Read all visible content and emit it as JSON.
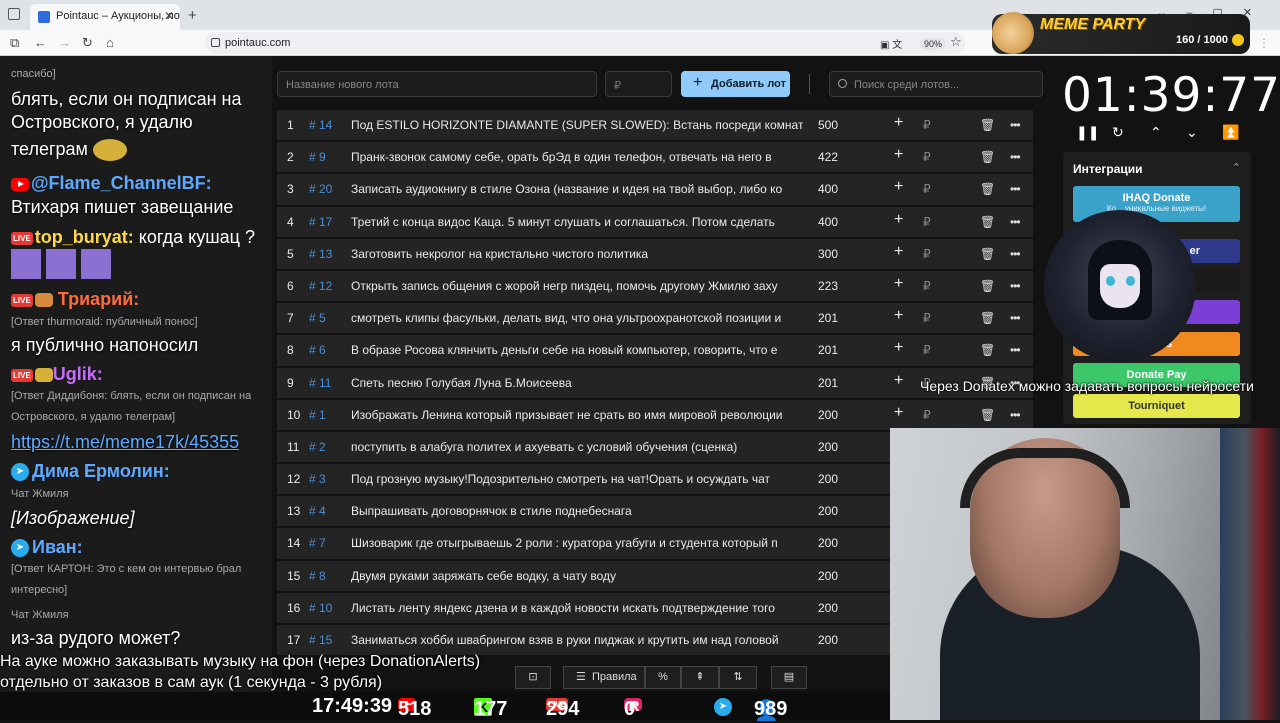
{
  "browser": {
    "tab_title": "Pointauc – Аукционы, лотереи",
    "url": "pointauc.com",
    "zoom": "90%"
  },
  "chat": {
    "lines": [
      {
        "kind": "small",
        "text": "спасибо]"
      },
      {
        "kind": "text",
        "text": "блять, если он подписан на"
      },
      {
        "kind": "text",
        "text": "Островского, я удалю"
      },
      {
        "kind": "text",
        "text": "телеграм"
      },
      {
        "kind": "name",
        "platform": "youtube",
        "name": "@Flame_ChannelBF:",
        "color": "#5ea8ff"
      },
      {
        "kind": "text",
        "text": "Втихаря пишет завещание"
      },
      {
        "kind": "name",
        "platform": "vk",
        "name": "top_buryat:",
        "color": "#ffd94a",
        "text": "когда кушац ?"
      },
      {
        "kind": "name",
        "platform": "vk",
        "name": "Триарий:",
        "color": "#ff6a3d"
      },
      {
        "kind": "small",
        "text": "[Ответ thurmoraid: публичный понос]"
      },
      {
        "kind": "text",
        "text": "я публично напоносил"
      },
      {
        "kind": "name",
        "platform": "vk",
        "name": "Uglik:",
        "color": "#c76bff"
      },
      {
        "kind": "small",
        "text": "[Ответ Диддибоня: блять, если он подписан на"
      },
      {
        "kind": "small",
        "text": "Островского, я удалю телеграм]"
      },
      {
        "kind": "link",
        "text": "https://t.me/meme17k/45355"
      },
      {
        "kind": "name",
        "platform": "telegram",
        "name": "Дима Ермолин:",
        "color": "#5ea8ff"
      },
      {
        "kind": "small",
        "text": "Чат Жмиля"
      },
      {
        "kind": "italic",
        "text": "[Изображение]"
      },
      {
        "kind": "name",
        "platform": "telegram",
        "name": "Иван:",
        "color": "#5ea8ff"
      },
      {
        "kind": "small",
        "text": "[Ответ КАРТОН: Это с кем он интервью брал"
      },
      {
        "kind": "small",
        "text": "интересно]"
      },
      {
        "kind": "small",
        "text": "Чат Жмиля"
      },
      {
        "kind": "text",
        "text": "из-за рудого может?"
      }
    ]
  },
  "toolbar": {
    "lot_placeholder": "Название нового лота",
    "price_placeholder": "₽",
    "add_label": "Добавить лот",
    "search_placeholder": "Поиск среди лотов..."
  },
  "lots": [
    {
      "idx": "1",
      "id": "# 14",
      "name": "Под ESTILO HORIZONTE DIAMANTE (SUPER SLOWED): Встань посреди комнаты",
      "amount": "500",
      "controls": true
    },
    {
      "idx": "2",
      "id": "# 9",
      "name": "Пранк-звонок самому себе, орать брЭд в один телефон, отвечать на него в",
      "amount": "422",
      "controls": true
    },
    {
      "idx": "3",
      "id": "# 20",
      "name": "Записать аудиокнигу в стиле Озона (название и идея на твой выбор, либо ко",
      "amount": "400",
      "controls": true
    },
    {
      "idx": "4",
      "id": "# 17",
      "name": "Третий с конца видос Каца. 5 минут слушать и соглашаться. Потом сделать",
      "amount": "400",
      "controls": true
    },
    {
      "idx": "5",
      "id": "# 13",
      "name": "Заготовить некролог на кристально чистого политика",
      "amount": "300",
      "controls": true
    },
    {
      "idx": "6",
      "id": "# 12",
      "name": "Открыть запись общения с жорой негр пиздец, помочь другому Жмилю заху",
      "amount": "223",
      "controls": true
    },
    {
      "idx": "7",
      "id": "# 5",
      "name": "смотреть клипы фасульки, делать вид, что она ультроохранотской позиции и",
      "amount": "201",
      "controls": true
    },
    {
      "idx": "8",
      "id": "# 6",
      "name": "В образе Росова клянчить деньги себе на новый компьютер, говорить, что е",
      "amount": "201",
      "controls": true
    },
    {
      "idx": "9",
      "id": "# 11",
      "name": "Спеть песню Голубая Луна Б.Моисеева",
      "amount": "201",
      "controls": true
    },
    {
      "idx": "10",
      "id": "# 1",
      "name": "Изображать Ленина который призывает не срать во имя мировой революции",
      "amount": "200",
      "controls": true
    },
    {
      "idx": "11",
      "id": "# 2",
      "name": "поступить в алабуга политех и ахуевать с условий обучения (сценка)",
      "amount": "200",
      "controls": false
    },
    {
      "idx": "12",
      "id": "# 3",
      "name": "Под грозную музыку!Подозрительно смотреть на чат!Орать и осуждать чат",
      "amount": "200",
      "controls": false
    },
    {
      "idx": "13",
      "id": "# 4",
      "name": "Выпрашивать договорнячок в стиле поднебеснага",
      "amount": "200",
      "controls": false
    },
    {
      "idx": "14",
      "id": "# 7",
      "name": "Шизоварик где отыгрываешь 2 роли : куратора угабуги и студента который п",
      "amount": "200",
      "controls": false
    },
    {
      "idx": "15",
      "id": "# 8",
      "name": "Двумя руками заряжать себе водку, а чату воду",
      "amount": "200",
      "controls": false
    },
    {
      "idx": "16",
      "id": "# 10",
      "name": "Листать ленту яндекс дзена и в каждой новости искать подтверждение того",
      "amount": "200",
      "controls": false
    },
    {
      "idx": "17",
      "id": "# 15",
      "name": "Заниматься хобби швабрингом взяв в руки пиджак и крутить им над головой",
      "amount": "200",
      "controls": false
    }
  ],
  "bottom_toolbar": {
    "rules_label": "Правила",
    "percent_label": "%"
  },
  "timer": {
    "value": "01:39:77"
  },
  "meme_party": {
    "title": "MEME PARTY",
    "progress": "160 / 1000"
  },
  "integrations": {
    "title": "Интеграции",
    "buttons": [
      {
        "label": "IHAQ Donate",
        "sub": "Ко... уникальные виджеты!",
        "color": "#3ba3c9"
      },
      {
        "label": "er",
        "color": "#2d3a8c"
      },
      {
        "label": "",
        "color": "#1a1a1a"
      },
      {
        "label": "",
        "color": "#7b3fd8"
      },
      {
        "label": "Alerts",
        "color": "#f08a20"
      },
      {
        "label": "Donate Pay",
        "color": "#3cc86a"
      },
      {
        "label": "Tourniquet",
        "color": "#e5e84a"
      }
    ]
  },
  "caption": "Через Donatex можно задавать вопросы нейросети",
  "overlay": {
    "line1": "На ауке можно заказывать музыку на фон (через DonationAlerts)",
    "line2": "отдельно от заказов в сам аук (1 секунда - 3 рубля)"
  },
  "status": {
    "time": "17:49:39",
    "youtube": "518",
    "kick": "177",
    "vk": "294",
    "rutube": "0",
    "telegram": "989"
  }
}
